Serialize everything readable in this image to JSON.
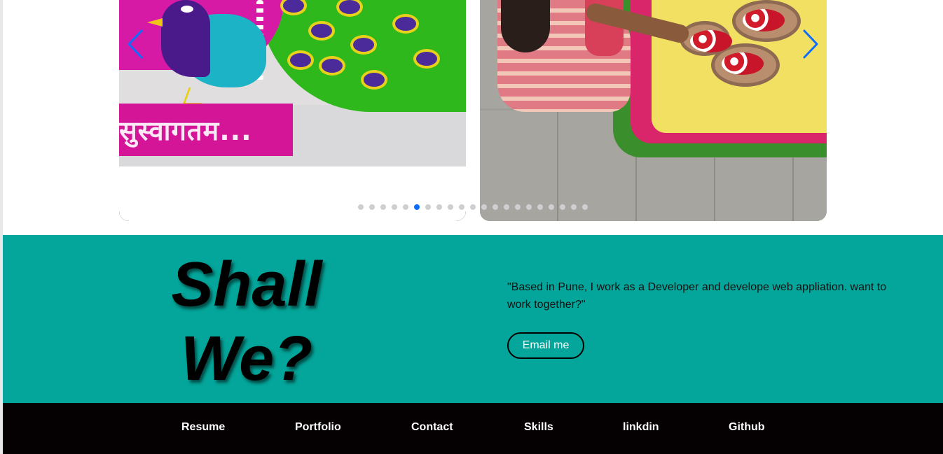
{
  "carousel": {
    "slides": [
      {
        "alt": "Rangoli peacock artwork",
        "banner_text": "सुस्वागतम..."
      },
      {
        "alt": "Flower rangoli with bowls"
      }
    ],
    "prev_icon": "chevron-left-icon",
    "next_icon": "chevron-right-icon",
    "indicator_count": 21,
    "active_indicator": 5,
    "colors": {
      "indicator_active": "#0d6efd",
      "indicator_inactive": "#cfcfcf",
      "arrow": "#0d6efd"
    }
  },
  "contact": {
    "heading": "Shall We?",
    "blurb": "\"Based in Pune, I work as a Developer and develope web appliation. want to work together?\"",
    "email_button": "Email me",
    "colors": {
      "background": "#04a59a"
    }
  },
  "footer": {
    "links": [
      "Resume",
      "Portfolio",
      "Contact",
      "Skills",
      "linkdin",
      "Github"
    ],
    "colors": {
      "background": "#050102",
      "text": "#ffffff"
    }
  }
}
